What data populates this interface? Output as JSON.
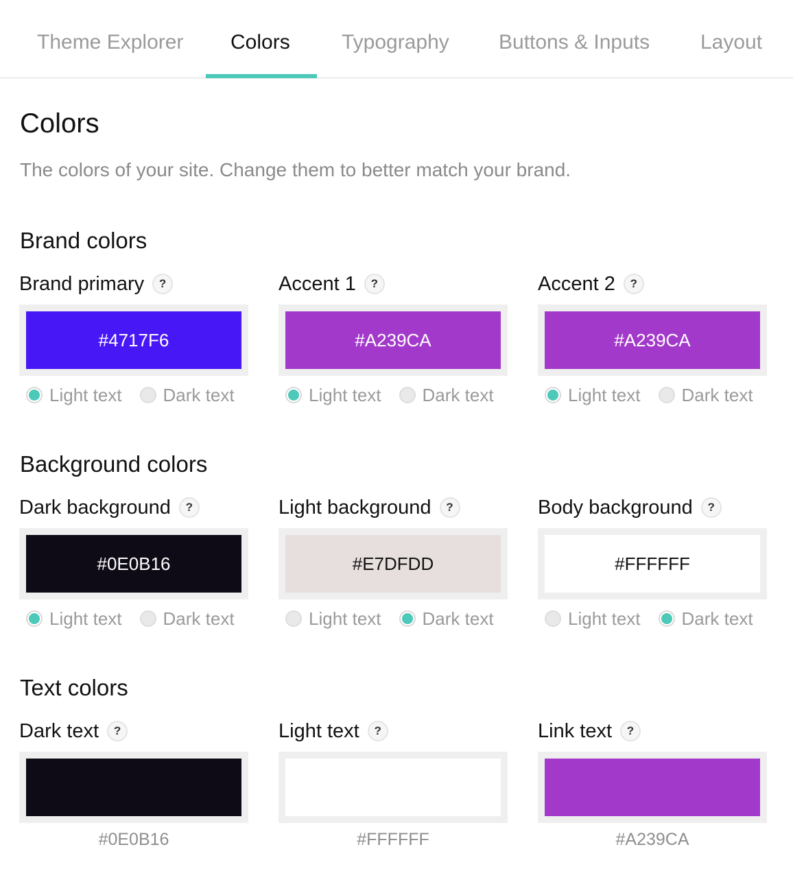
{
  "tabs": [
    {
      "label": "Theme Explorer"
    },
    {
      "label": "Colors"
    },
    {
      "label": "Typography"
    },
    {
      "label": "Buttons & Inputs"
    },
    {
      "label": "Layout"
    }
  ],
  "active_tab": "Colors",
  "page": {
    "title": "Colors",
    "subtitle": "The colors of your site. Change them to better match your brand."
  },
  "help_glyph": "?",
  "radio_labels": {
    "light": "Light text",
    "dark": "Dark text"
  },
  "accent_color": "#4CC9B8",
  "sections": {
    "brand": {
      "title": "Brand colors",
      "cards": [
        {
          "label": "Brand primary",
          "hex": "#4717F6",
          "text_mode": "light"
        },
        {
          "label": "Accent 1",
          "hex": "#A239CA",
          "text_mode": "light"
        },
        {
          "label": "Accent 2",
          "hex": "#A239CA",
          "text_mode": "light"
        }
      ]
    },
    "background": {
      "title": "Background colors",
      "cards": [
        {
          "label": "Dark background",
          "hex": "#0E0B16",
          "text_mode": "light"
        },
        {
          "label": "Light background",
          "hex": "#E7DFDD",
          "text_mode": "dark"
        },
        {
          "label": "Body background",
          "hex": "#FFFFFF",
          "text_mode": "dark"
        }
      ]
    },
    "text": {
      "title": "Text colors",
      "cards": [
        {
          "label": "Dark text",
          "hex": "#0E0B16"
        },
        {
          "label": "Light text",
          "hex": "#FFFFFF"
        },
        {
          "label": "Link text",
          "hex": "#A239CA"
        }
      ]
    }
  }
}
